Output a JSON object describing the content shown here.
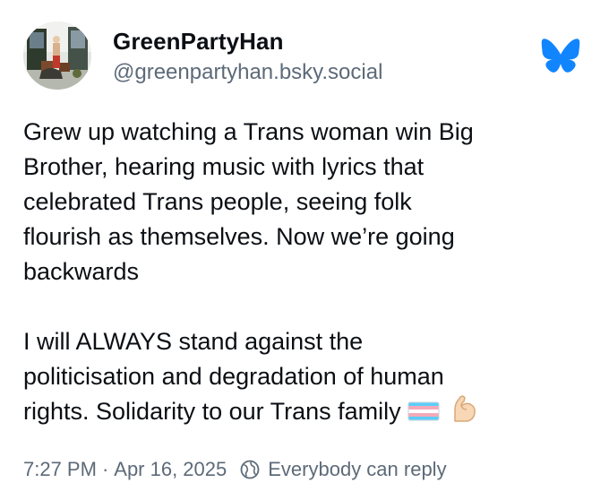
{
  "post": {
    "author": {
      "display_name": "GreenPartyHan",
      "handle": "@greenpartyhan.bsky.social"
    },
    "paragraph_1_lines": [
      "Grew up watching a Trans woman win Big",
      "Brother, hearing music with lyrics that",
      "celebrated Trans people, seeing folk",
      "flourish as themselves. Now we’re going",
      "backwards"
    ],
    "paragraph_2_lines": [
      "I will ALWAYS stand against the",
      "politicisation and degradation of human",
      "rights. Solidarity to our Trans family"
    ],
    "emojis": [
      "transgender-flag-icon",
      "flexed-biceps-icon"
    ],
    "time": "7:27 PM",
    "separator": "·",
    "date": "Apr 16, 2025",
    "reply_setting": "Everybody can reply"
  },
  "colors": {
    "text": "#0b0f14",
    "muted": "#5d6a78",
    "bluesky_blue": "#1185fe",
    "trans_blue": "#5bcefa",
    "trans_pink": "#f5a9b8"
  }
}
